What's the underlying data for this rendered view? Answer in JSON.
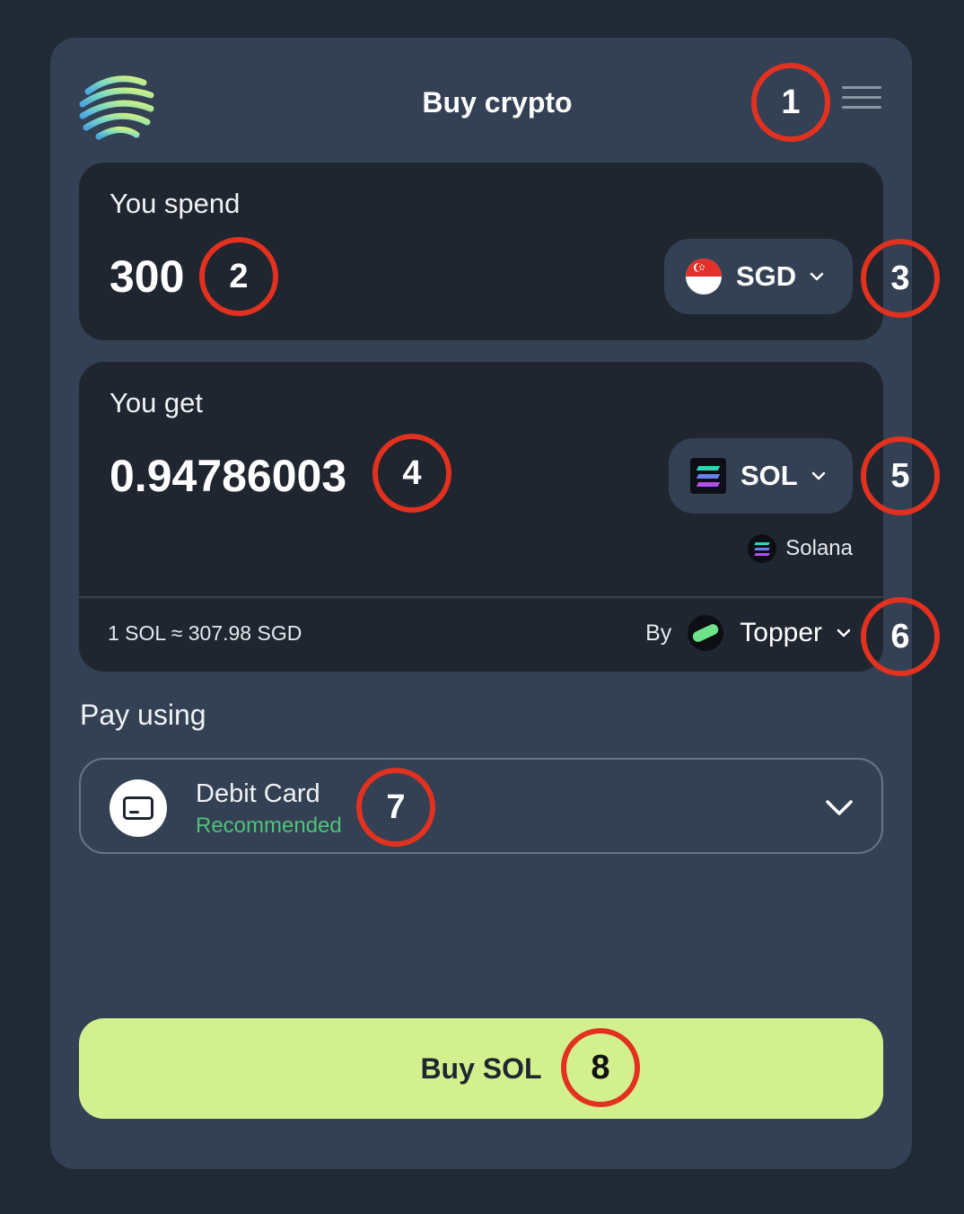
{
  "header": {
    "logo_icon": "swirl-logo-icon",
    "title": "Buy crypto",
    "menu_icon": "hamburger-menu-icon"
  },
  "spend": {
    "label": "You spend",
    "amount": "300",
    "currency": {
      "code": "SGD",
      "icon": "singapore-flag-icon"
    }
  },
  "get": {
    "label": "You get",
    "amount": "0.94786003",
    "currency": {
      "code": "SOL",
      "icon": "solana-icon"
    },
    "network": "Solana",
    "rate": "1 SOL ≈ 307.98 SGD",
    "provider": {
      "by_label": "By",
      "name": "Topper",
      "icon": "topper-logo-icon"
    }
  },
  "payment": {
    "label": "Pay using",
    "method": "Debit Card",
    "badge": "Recommended",
    "icon": "credit-card-icon"
  },
  "action": {
    "buy_label": "Buy SOL"
  },
  "annotations": [
    "1",
    "2",
    "3",
    "4",
    "5",
    "6",
    "7",
    "8"
  ],
  "colors": {
    "background": "#202a36",
    "card": "#344154",
    "panel": "#1f2630",
    "accent_button": "#d3f08e",
    "recommended": "#4fc27a",
    "annotation_circle": "#e2311f"
  }
}
